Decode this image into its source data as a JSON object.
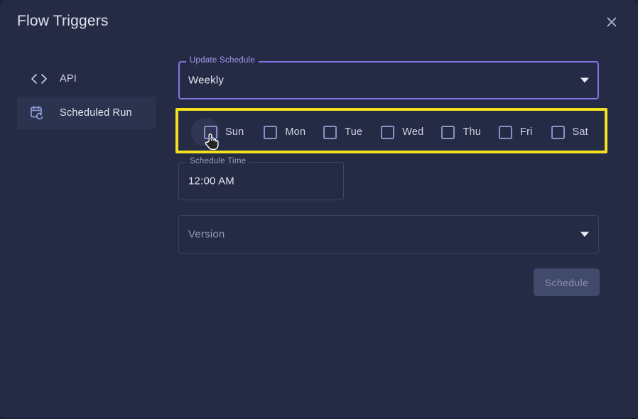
{
  "window": {
    "title": "Flow Triggers",
    "close_icon": "close-icon",
    "background": "#252b45",
    "outer_background": "#1b2138"
  },
  "sidebar": {
    "items": [
      {
        "label": "API",
        "icon": "code-brackets-icon",
        "selected": false
      },
      {
        "label": "Scheduled Run",
        "icon": "calendar-refresh-icon",
        "selected": true
      }
    ]
  },
  "form": {
    "update_schedule": {
      "label": "Update Schedule",
      "value": "Weekly",
      "caret_icon": "chevron-down-icon",
      "focused": true,
      "accent": "#8177e8"
    },
    "days": {
      "highlight_color": "#f5e020",
      "items": [
        {
          "label": "Sun",
          "checked": false,
          "hovered": true
        },
        {
          "label": "Mon",
          "checked": false,
          "hovered": false
        },
        {
          "label": "Tue",
          "checked": false,
          "hovered": false
        },
        {
          "label": "Wed",
          "checked": false,
          "hovered": false
        },
        {
          "label": "Thu",
          "checked": false,
          "hovered": false
        },
        {
          "label": "Fri",
          "checked": false,
          "hovered": false
        },
        {
          "label": "Sat",
          "checked": false,
          "hovered": false
        }
      ]
    },
    "schedule_time": {
      "label": "Schedule Time",
      "value": "12:00 AM"
    },
    "version": {
      "placeholder": "Version",
      "value": "",
      "caret_icon": "chevron-down-icon"
    },
    "submit": {
      "label": "Schedule",
      "disabled": true
    }
  }
}
